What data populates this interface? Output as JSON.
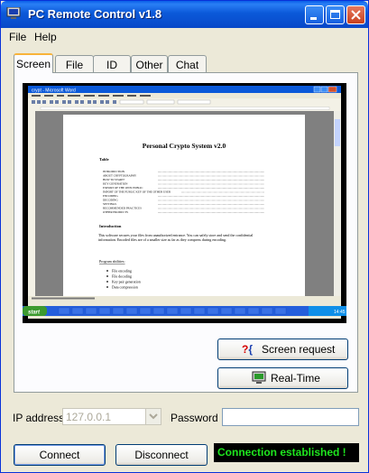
{
  "window": {
    "title": "PC Remote Control v1.8"
  },
  "menu": {
    "file": "File",
    "help": "Help"
  },
  "tabs": [
    {
      "label": "Screen"
    },
    {
      "label": "File"
    },
    {
      "label": "ID"
    },
    {
      "label": "Other"
    },
    {
      "label": "Chat"
    }
  ],
  "remote_screen": {
    "word_title_bar": "crypt - Microsoft Word",
    "doc_title": "Personal Crypto System v2.0",
    "toc_heading": "Table",
    "toc_items": [
      "INTRODUCTION",
      "ABOUT CRYPTOGRAPHY",
      "HOW TO START?",
      "KEY GENERATION",
      "EXPORT OF THE OWN PUBLIC",
      "IMPORT OF THE PUBLIC KEY OF THE OTHER USER",
      "ENCODING",
      "DECODING",
      "SETTINGS",
      "RECOMMENDED PRACTICES",
      "OTHER PRODUCTS"
    ],
    "intro_heading": "Introduction",
    "intro_text": "This software secures your files from unauthorized entrance. You can safely store and send the confidential information. Encoded files are of a smaller size as far as they compress during encoding.",
    "program_abilities": "Program abilities:",
    "abilities": [
      "File encoding",
      "File decoding",
      "Key pair generation",
      "Data compression"
    ],
    "start": "start",
    "clock": "14:45"
  },
  "buttons": {
    "screen_request": "Screen request",
    "real_time": "Real-Time",
    "connect": "Connect",
    "disconnect": "Disconnect"
  },
  "form": {
    "ip_label": "IP address",
    "ip_value": "127.0.0.1",
    "password_label": "Password",
    "password_value": ""
  },
  "status": {
    "text": "Connection established !",
    "color": "#1ee61e"
  },
  "colors": {
    "titlebar": "#0b59d9",
    "taskbar": "#245edb",
    "start": "#3c9a2e"
  }
}
